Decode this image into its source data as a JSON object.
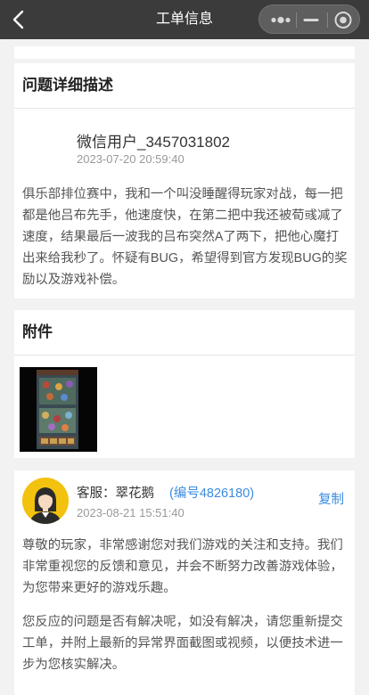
{
  "navbar": {
    "title": "工单信息",
    "back_icon": "chevron-left-icon",
    "capsule_icons": [
      "more-dots-icon",
      "minimize-icon",
      "close-circle-icon"
    ]
  },
  "description_section": {
    "title": "问题详细描述",
    "user_name": "微信用户_3457031802",
    "time": "2023-07-20 20:59:40",
    "text": "俱乐部排位赛中，我和一个叫没睡醒得玩家对战，每一把都是他吕布先手，他速度快，在第二把中我还被荀彧减了速度，结果最后一波我的吕布突然A了两下，把他心魔打出来给我秒了。怀疑有BUG，希望得到官方发现BUG的奖励以及游戏补偿。"
  },
  "attachment_section": {
    "title": "附件",
    "thumbnail_icon": "game-screenshot-thumbnail"
  },
  "reply": {
    "agent_label": "客服：翠花鹅",
    "agent_code": "(编号4826180)",
    "time": "2023-08-21 15:51:40",
    "copy_label": "复制",
    "paragraph1": "尊敬的玩家，非常感谢您对我们游戏的关注和支持。我们非常重视您的反馈和意见，并会不断努力改善游戏体验，为您带来更好的游戏乐趣。",
    "paragraph2": "您反应的问题是否有解决呢，如没有解决，请您重新提交工单，并附上最新的异常界面截图或视频，以便技术进一步为您核实解决。"
  },
  "colors": {
    "navbar_bg": "#3b3b3b",
    "page_bg": "#f2f2f2",
    "accent_blue": "#3a8ce0",
    "avatar_bg": "#f3c20f"
  }
}
